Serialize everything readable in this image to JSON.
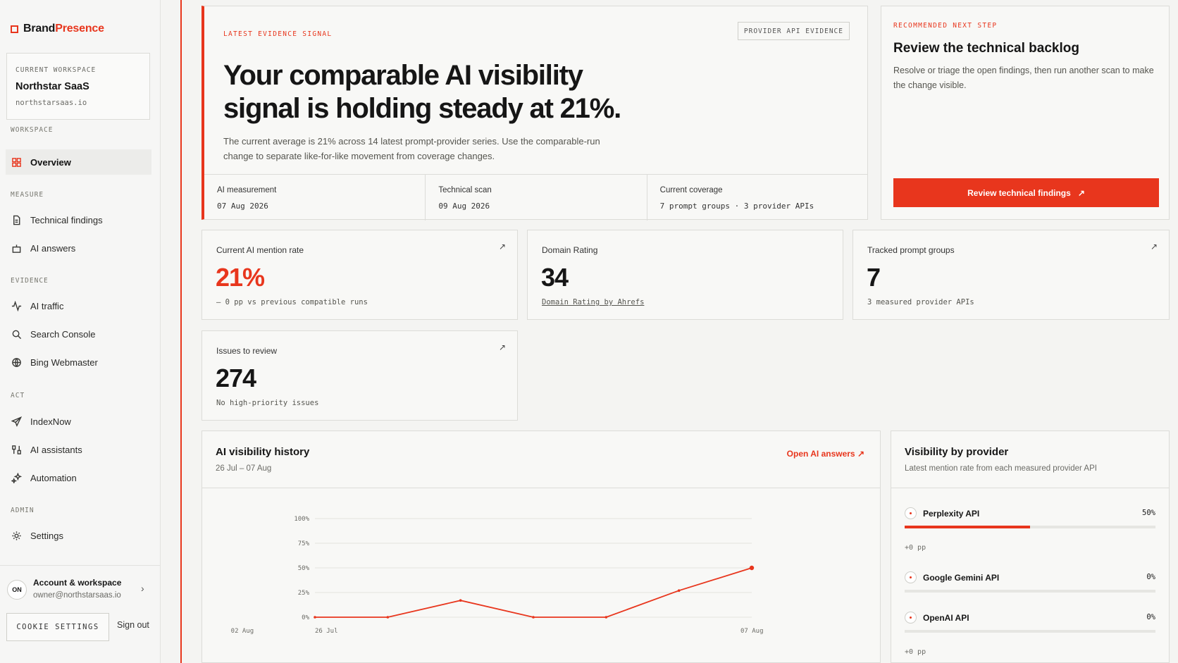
{
  "brand": {
    "part1": "Brand",
    "part2": "Presence"
  },
  "workspace": {
    "label": "CURRENT WORKSPACE",
    "name": "Northstar SaaS",
    "domain": "northstarsaas.io"
  },
  "sidebar": {
    "sections": [
      "WORKSPACE",
      "MEASURE",
      "EVIDENCE",
      "ACT",
      "ADMIN"
    ],
    "items": [
      {
        "label": "Overview",
        "icon": "grid-icon"
      },
      {
        "label": "Technical findings",
        "icon": "document-icon"
      },
      {
        "label": "AI answers",
        "icon": "robot-icon"
      },
      {
        "label": "AI traffic",
        "icon": "activity-icon"
      },
      {
        "label": "Search Console",
        "icon": "search-icon"
      },
      {
        "label": "Bing Webmaster",
        "icon": "globe-icon"
      },
      {
        "label": "IndexNow",
        "icon": "send-icon"
      },
      {
        "label": "AI assistants",
        "icon": "assistants-icon"
      },
      {
        "label": "Automation",
        "icon": "sparkle-icon"
      },
      {
        "label": "Settings",
        "icon": "gear-icon"
      }
    ]
  },
  "account": {
    "initials": "ON",
    "title": "Account & workspace",
    "email": "owner@northstarsaas.io",
    "chevron": "›"
  },
  "footer": {
    "cookie": "COOKIE SETTINGS",
    "signout": "Sign out"
  },
  "hero": {
    "kicker": "LATEST EVIDENCE SIGNAL",
    "tag": "PROVIDER API EVIDENCE",
    "headline": "Your comparable AI visibility signal is holding steady at 21%.",
    "description": "The current average is 21% across 14 latest prompt-provider series. Use the comparable-run change to separate like-for-like movement from coverage changes.",
    "stats": [
      {
        "label": "AI measurement",
        "value": "07 Aug 2026"
      },
      {
        "label": "Technical scan",
        "value": "09 Aug 2026"
      },
      {
        "label": "Current coverage",
        "value": "7 prompt groups · 3 provider APIs"
      }
    ]
  },
  "next": {
    "kicker": "RECOMMENDED NEXT STEP",
    "title": "Review the technical backlog",
    "description": "Resolve or triage the open findings, then run another scan to make the change visible.",
    "cta": "Review technical findings",
    "cta_arrow": "↗"
  },
  "metrics": [
    {
      "label": "Current AI mention rate",
      "value": "21%",
      "sub": "– 0 pp vs previous compatible runs",
      "arrow": "↗"
    },
    {
      "label": "Domain Rating",
      "value": "34",
      "sub": "Domain Rating by Ahrefs",
      "arrow": ""
    },
    {
      "label": "Tracked prompt groups",
      "value": "7",
      "sub": "3 measured provider APIs",
      "arrow": "↗"
    },
    {
      "label": "Issues to review",
      "value": "274",
      "sub": "No high-priority issues",
      "arrow": "↗"
    }
  ],
  "history": {
    "title": "AI visibility history",
    "range": "26 Jul – 07 Aug",
    "link": "Open AI answers",
    "link_arrow": "↗"
  },
  "chart_data": {
    "type": "line",
    "x": [
      "26 Jul",
      "28 Jul",
      "30 Jul",
      "01 Aug",
      "03 Aug",
      "05 Aug",
      "07 Aug"
    ],
    "x_tick_labels": [
      "26 Jul",
      "02 Aug",
      "07 Aug"
    ],
    "series": [
      {
        "values": [
          0,
          0,
          17,
          0,
          0,
          27,
          50
        ]
      }
    ],
    "ylim": [
      0,
      100
    ],
    "y_ticks": [
      "0%",
      "25%",
      "50%",
      "75%",
      "100%"
    ],
    "grid": true,
    "color": "#e8361d"
  },
  "providers": {
    "title": "Visibility by provider",
    "subtitle": "Latest mention rate from each measured provider API",
    "items": [
      {
        "name": "Perplexity API",
        "pct": "50%",
        "value": 50,
        "change": "+0 pp"
      },
      {
        "name": "Google Gemini API",
        "pct": "0%",
        "value": 0,
        "change": ""
      },
      {
        "name": "OpenAI API",
        "pct": "0%",
        "value": 0,
        "change": "+0 pp"
      }
    ]
  },
  "colors": {
    "accent": "#e8361d",
    "background": "#f4f4f2",
    "panel": "#f8f8f6"
  }
}
